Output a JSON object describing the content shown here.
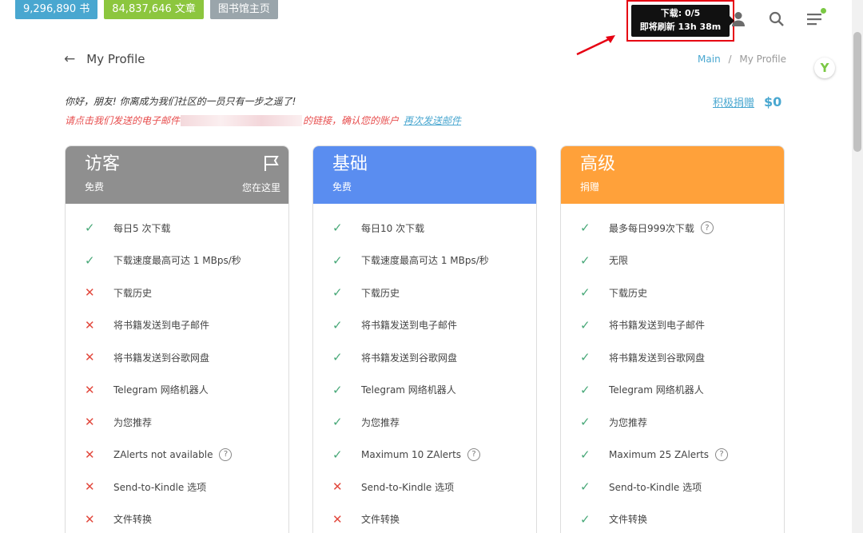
{
  "header": {
    "stats": {
      "books": "9,296,890 书",
      "articles": "84,837,646 文章",
      "home": "图书馆主页"
    },
    "tooltip": {
      "line1": "下载: 0/5",
      "line2": "即将刷新 13h 38m"
    }
  },
  "page": {
    "title": "My Profile",
    "breadcrumb": {
      "main": "Main",
      "separator": "/",
      "current": "My Profile"
    }
  },
  "notice": {
    "greeting": "你好，朋友! 你离成为我们社区的一员只有一步之遥了!",
    "warning_prefix": "请点击我们发送的电子邮件",
    "warning_suffix": "的链接，确认您的账户",
    "resend": "再次发送邮件"
  },
  "donate": {
    "link": "积极捐赠",
    "amount": "$0"
  },
  "colors": {
    "guest": "#8f8f8f",
    "basic": "#5a8df0",
    "premium": "#ffa13a",
    "check": "#48a878",
    "cross": "#e2483d",
    "highlight": "#e60012"
  },
  "plans": [
    {
      "title": "访客",
      "subtitle": "免费",
      "current_label": "您在这里",
      "features": [
        {
          "text": "每日5 次下载",
          "ok": true
        },
        {
          "text": "下载速度最高可达 1 MBps/秒",
          "ok": true
        },
        {
          "text": "下载历史",
          "ok": false
        },
        {
          "text": "将书籍发送到电子邮件",
          "ok": false
        },
        {
          "text": "将书籍发送到谷歌网盘",
          "ok": false
        },
        {
          "text": "Telegram 网络机器人",
          "ok": false
        },
        {
          "text": "为您推荐",
          "ok": false
        },
        {
          "text": "ZAlerts not available",
          "ok": false,
          "help": true
        },
        {
          "text": "Send-to-Kindle 选项",
          "ok": false
        },
        {
          "text": "文件转换",
          "ok": false
        }
      ]
    },
    {
      "title": "基础",
      "subtitle": "免费",
      "features": [
        {
          "text": "每日10 次下载",
          "ok": true
        },
        {
          "text": "下载速度最高可达 1 MBps/秒",
          "ok": true
        },
        {
          "text": "下载历史",
          "ok": true
        },
        {
          "text": "将书籍发送到电子邮件",
          "ok": true
        },
        {
          "text": "将书籍发送到谷歌网盘",
          "ok": true
        },
        {
          "text": "Telegram 网络机器人",
          "ok": true
        },
        {
          "text": "为您推荐",
          "ok": true
        },
        {
          "text": "Maximum 10 ZAlerts",
          "ok": true,
          "help": true
        },
        {
          "text": "Send-to-Kindle 选项",
          "ok": false
        },
        {
          "text": "文件转换",
          "ok": false
        }
      ]
    },
    {
      "title": "高级",
      "subtitle": "捐赠",
      "features": [
        {
          "text": "最多每日999次下载",
          "ok": true,
          "help": true
        },
        {
          "text": "无限",
          "ok": true
        },
        {
          "text": "下载历史",
          "ok": true
        },
        {
          "text": "将书籍发送到电子邮件",
          "ok": true
        },
        {
          "text": "将书籍发送到谷歌网盘",
          "ok": true
        },
        {
          "text": "Telegram 网络机器人",
          "ok": true
        },
        {
          "text": "为您推荐",
          "ok": true
        },
        {
          "text": "Maximum 25 ZAlerts",
          "ok": true,
          "help": true
        },
        {
          "text": "Send-to-Kindle 选项",
          "ok": true
        },
        {
          "text": "文件转换",
          "ok": true
        }
      ]
    }
  ]
}
